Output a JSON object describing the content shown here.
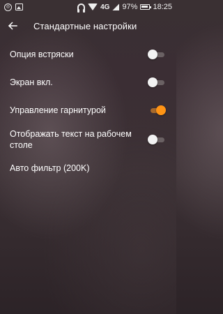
{
  "status_bar": {
    "left_icons": [
      "app-notification-icon",
      "image-icon"
    ],
    "right_icons": [
      "headset-icon",
      "wifi-icon",
      "signal-icon",
      "battery-icon"
    ],
    "network": "4G",
    "battery": "97%",
    "time": "18:25"
  },
  "toolbar": {
    "back_icon": "arrow-left-icon",
    "title": "Стандартные настройки"
  },
  "settings": [
    {
      "label": "Опция встряски",
      "toggle": false
    },
    {
      "label": "Экран вкл.",
      "toggle": false
    },
    {
      "label": "Управление гарнитурой",
      "toggle": true
    },
    {
      "label": "Отображать текст на рабочем столе",
      "toggle": false
    },
    {
      "label": "Авто фильтр (200K)",
      "toggle": null
    }
  ],
  "colors": {
    "accent": "#ff9415",
    "text": "#ffffff",
    "toggle_off_thumb": "#f2f2f2",
    "toggle_off_track": "#6a6163"
  }
}
